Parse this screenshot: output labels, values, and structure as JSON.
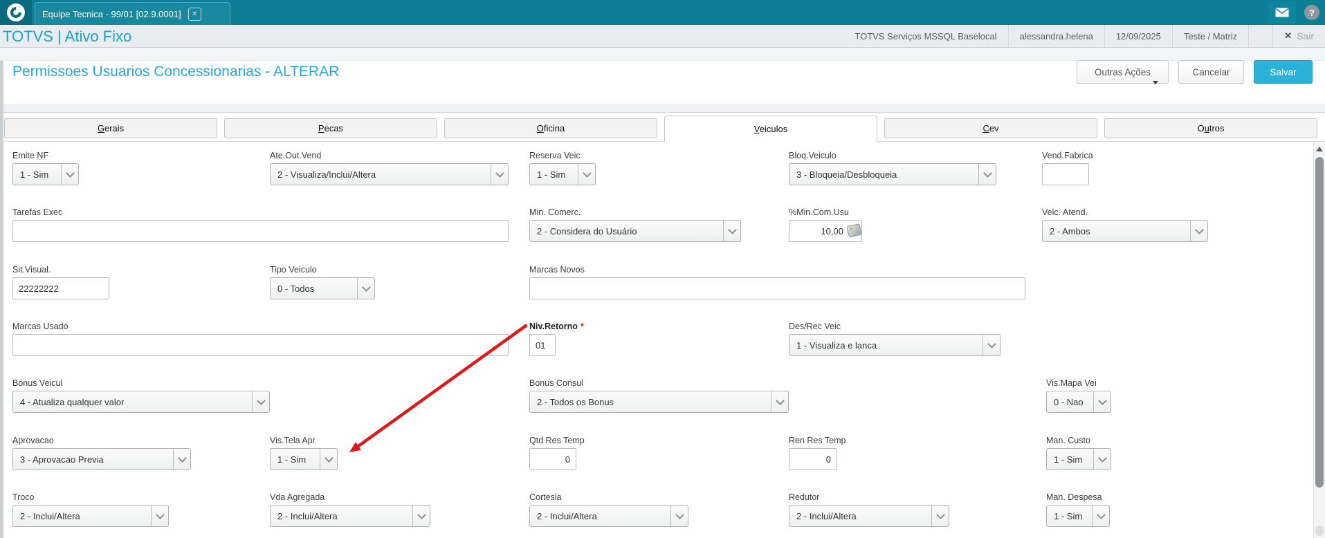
{
  "colors": {
    "topbar": "#0c7e95",
    "topbar_tab": "#17899f",
    "logo_tile": "#09697e",
    "header_bg": "#e9edf0",
    "brand_blue": "#18a4cc",
    "title_blue": "#22aadd",
    "accent": "#29b1d8"
  },
  "topbar": {
    "tab_title": "Equipe Tecnica - 99/01 [02.9.0001]",
    "close_glyph": "✕",
    "help_glyph": "?"
  },
  "header": {
    "brand": "TOTVS | Ativo Fixo",
    "environment": "TOTVS Serviços MSSQL Baselocal",
    "user": "alessandra.helena",
    "date": "12/09/2025",
    "company": "Teste / Matriz",
    "logout_x": "✕",
    "logout": "Sair"
  },
  "toolbar": {
    "title": "Permissoes Usuarios Concessionarias - ALTERAR",
    "other_actions": "Outras Ações",
    "cancel": "Cancelar",
    "save": "Salvar"
  },
  "tabs": [
    {
      "pre": "",
      "u": "G",
      "post": "erais"
    },
    {
      "pre": "",
      "u": "P",
      "post": "ecas"
    },
    {
      "pre": "",
      "u": "O",
      "post": "ficina"
    },
    {
      "pre": "",
      "u": "V",
      "post": "eiculos"
    },
    {
      "pre": "",
      "u": "C",
      "post": "ev"
    },
    {
      "pre": "O",
      "u": "u",
      "post": "tros"
    }
  ],
  "fields": {
    "emite_nf": {
      "label": "Emite NF",
      "value": "1 - Sim"
    },
    "ate_out_vend": {
      "label": "Ate.Out.Vend",
      "value": "2 - Visualiza/Inclui/Altera"
    },
    "reserva_veic": {
      "label": "Reserva Veic",
      "value": "1 - Sim"
    },
    "bloq_veiculo": {
      "label": "Bloq.Veiculo",
      "value": "3 - Bloqueia/Desbloqueia"
    },
    "vend_fabrica": {
      "label": "Vend.Fabrica",
      "value": ""
    },
    "tarefas_exec": {
      "label": "Tarefas Exec",
      "value": ""
    },
    "min_comerc": {
      "label": "Min. Comerc.",
      "value": "2 - Considera do Usuário"
    },
    "min_com_usu": {
      "label": "%Min.Com.Usu",
      "value": "10,00"
    },
    "veic_atend": {
      "label": "Veic. Atend.",
      "value": "2 - Ambos"
    },
    "sit_visual": {
      "label": "Sit.Visual.",
      "value": "22222222"
    },
    "tipo_veiculo": {
      "label": "Tipo Veiculo",
      "value": "0 - Todos"
    },
    "marcas_novos": {
      "label": "Marcas Novos",
      "value": ""
    },
    "marcas_usado": {
      "label": "Marcas Usado",
      "value": ""
    },
    "niv_retorno": {
      "label": "Niv.Retorno",
      "value": "01",
      "required": "*"
    },
    "des_rec_veic": {
      "label": "Des/Rec Veic",
      "value": "1 - Visualiza e lanca"
    },
    "bonus_veicul": {
      "label": "Bonus Veicul",
      "value": "4 - Atualiza qualquer valor"
    },
    "bonus_consul": {
      "label": "Bonus Consul",
      "value": "2 - Todos os Bonus"
    },
    "vis_mapa_vei": {
      "label": "Vis.Mapa Vei",
      "value": "0 - Nao"
    },
    "aprovacao": {
      "label": "Aprovacao",
      "value": "3 - Aprovacao Previa"
    },
    "vis_tela_apr": {
      "label": "Vis.Tela Apr",
      "value": "1 - Sim"
    },
    "qtd_res_temp": {
      "label": "Qtd Res Temp",
      "value": "0"
    },
    "ren_res_temp": {
      "label": "Ren Res Temp",
      "value": "0"
    },
    "man_custo": {
      "label": "Man. Custo",
      "value": "1 - Sim"
    },
    "troco": {
      "label": "Troco",
      "value": "2 - Inclui/Altera"
    },
    "vda_agregada": {
      "label": "Vda Agregada",
      "value": "2 - Inclui/Altera"
    },
    "cortesia": {
      "label": "Cortesia",
      "value": "2 - Inclui/Altera"
    },
    "redutor": {
      "label": "Redutor",
      "value": "2 - Inclui/Altera"
    },
    "man_despesa": {
      "label": "Man. Despesa",
      "value": "1 - Sim"
    }
  },
  "annotation": {
    "arrow_color": "#e21717"
  }
}
